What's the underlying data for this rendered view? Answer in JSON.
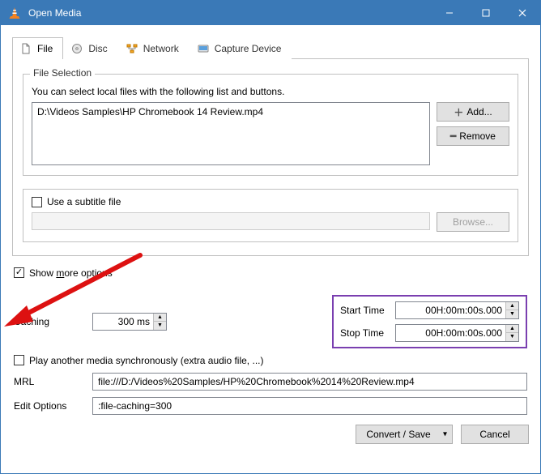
{
  "window": {
    "title": "Open Media"
  },
  "tabs": {
    "file": "File",
    "disc": "Disc",
    "network": "Network",
    "capture": "Capture Device"
  },
  "file_selection": {
    "legend": "File Selection",
    "hint": "You can select local files with the following list and buttons.",
    "files": [
      "D:\\Videos Samples\\HP Chromebook 14 Review.mp4"
    ],
    "add_btn": "Add...",
    "remove_btn": "Remove"
  },
  "subtitle": {
    "checkbox_label": "Use a subtitle file",
    "browse_btn": "Browse..."
  },
  "show_more": {
    "label_prefix": "Show ",
    "label_underlined": "m",
    "label_suffix": "ore options",
    "checked": true
  },
  "options": {
    "caching_label": "Caching",
    "caching_value": "300 ms",
    "start_time_label": "Start Time",
    "start_time_value": "00H:00m:00s.000",
    "stop_time_label": "Stop Time",
    "stop_time_value": "00H:00m:00s.000",
    "sync_label": "Play another media synchronously (extra audio file, ...)",
    "mrl_label": "MRL",
    "mrl_value": "file:///D:/Videos%20Samples/HP%20Chromebook%2014%20Review.mp4",
    "edit_options_label": "Edit Options",
    "edit_options_value": ":file-caching=300"
  },
  "footer": {
    "convert_btn": "Convert / Save",
    "cancel_btn": "Cancel"
  }
}
